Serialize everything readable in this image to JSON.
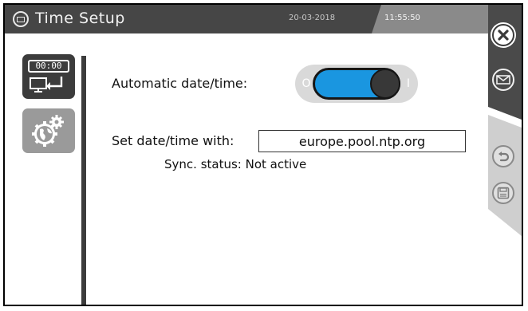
{
  "header": {
    "title": "Time Setup",
    "date": "20-03-2018",
    "time": "11:55:50"
  },
  "nav": {
    "datetime_tile": {
      "clock_text": "00:00",
      "icon": "date-time-settings-icon",
      "selected": true
    },
    "network_tile": {
      "icon": "network-globe-gear-icon",
      "selected": false
    }
  },
  "main": {
    "auto_datetime": {
      "label": "Automatic date/time:",
      "toggle_off_symbol": "O",
      "toggle_on_symbol": "I",
      "enabled": true
    },
    "ntp": {
      "label": "Set date/time with:",
      "value": "europe.pool.ntp.org"
    },
    "sync": {
      "label": "Sync. status: Not active"
    }
  },
  "actions": {
    "close_icon": "close-icon",
    "send_icon": "envelope-icon",
    "undo_icon": "undo-icon",
    "save_icon": "floppy-disk-icon"
  },
  "colors": {
    "header_bg": "#464646",
    "toggle_on": "#1a96e0",
    "nav_selected": "#3c3c3c",
    "nav_unselected": "#9a9a9a"
  }
}
